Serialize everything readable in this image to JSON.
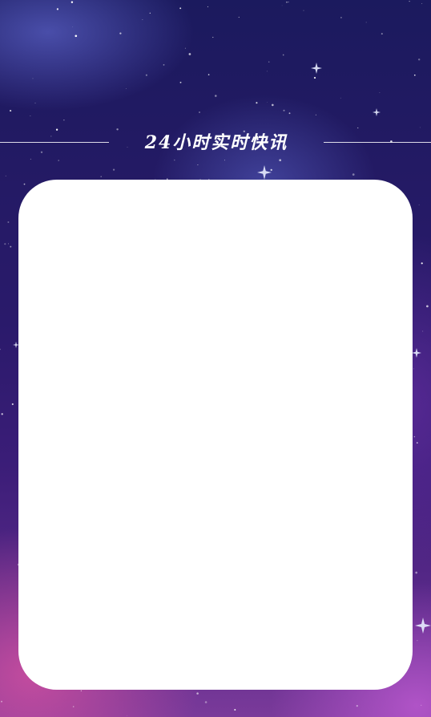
{
  "header": {
    "title": "24小时实时快讯"
  },
  "colors": {
    "background_top": "#1b1a5e",
    "background_bottom": "#7a3a9a",
    "card": "#ffffff",
    "title_text": "#ffffff"
  }
}
